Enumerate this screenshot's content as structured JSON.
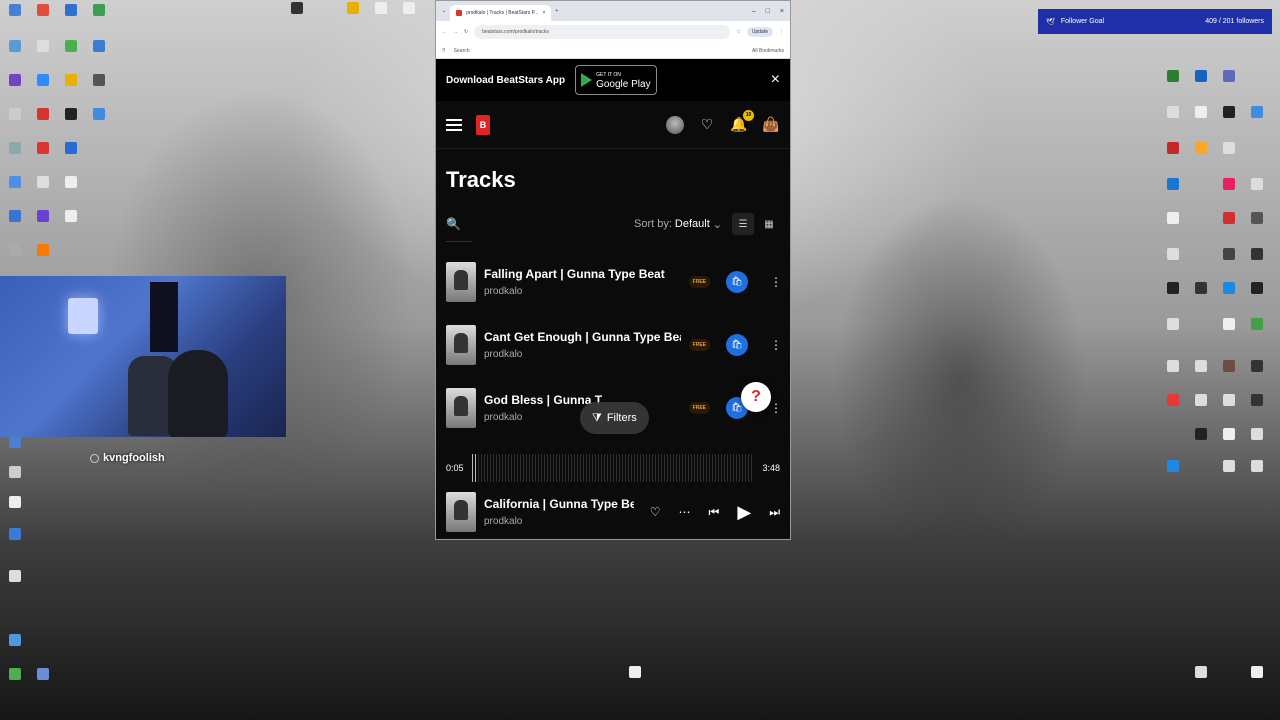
{
  "browser": {
    "tab_title": "prodkalo | Tracks | BeatStars P...",
    "url": "beatstars.com/prodkalo/tracks",
    "update_label": "Update",
    "bookmark_search": "Search",
    "all_bookmarks": "All Bookmarks"
  },
  "app_banner": {
    "text": "Download BeatStars App",
    "play_small": "GET IT ON",
    "play_big": "Google Play",
    "close": "×"
  },
  "nav": {
    "notification_count": "10"
  },
  "page": {
    "title": "Tracks",
    "sort_label": "Sort by:",
    "sort_value": "Default"
  },
  "tracks": [
    {
      "title": "Falling Apart | Gunna Type Beat",
      "artist": "prodkalo",
      "tag": "FREE"
    },
    {
      "title": "Cant Get Enough | Gunna Type Beat",
      "artist": "prodkalo",
      "tag": "FREE"
    },
    {
      "title": "God Bless | Gunna T",
      "artist": "prodkalo",
      "tag": "FREE"
    }
  ],
  "filters_label": "Filters",
  "help_label": "?",
  "player": {
    "elapsed": "0:05",
    "duration": "3:48",
    "progress_fraction": 0.02,
    "title": "California | Gunna Type Beat",
    "artist": "prodkalo"
  },
  "stream": {
    "username": "kvngfoolish",
    "follower_goal_label": "Follower Goal",
    "follower_goal_count": "409 / 201 followers"
  },
  "colors": {
    "accent_blue": "#1f6fe0",
    "brand_red": "#e02525",
    "free_tag": "#e69a3a"
  }
}
